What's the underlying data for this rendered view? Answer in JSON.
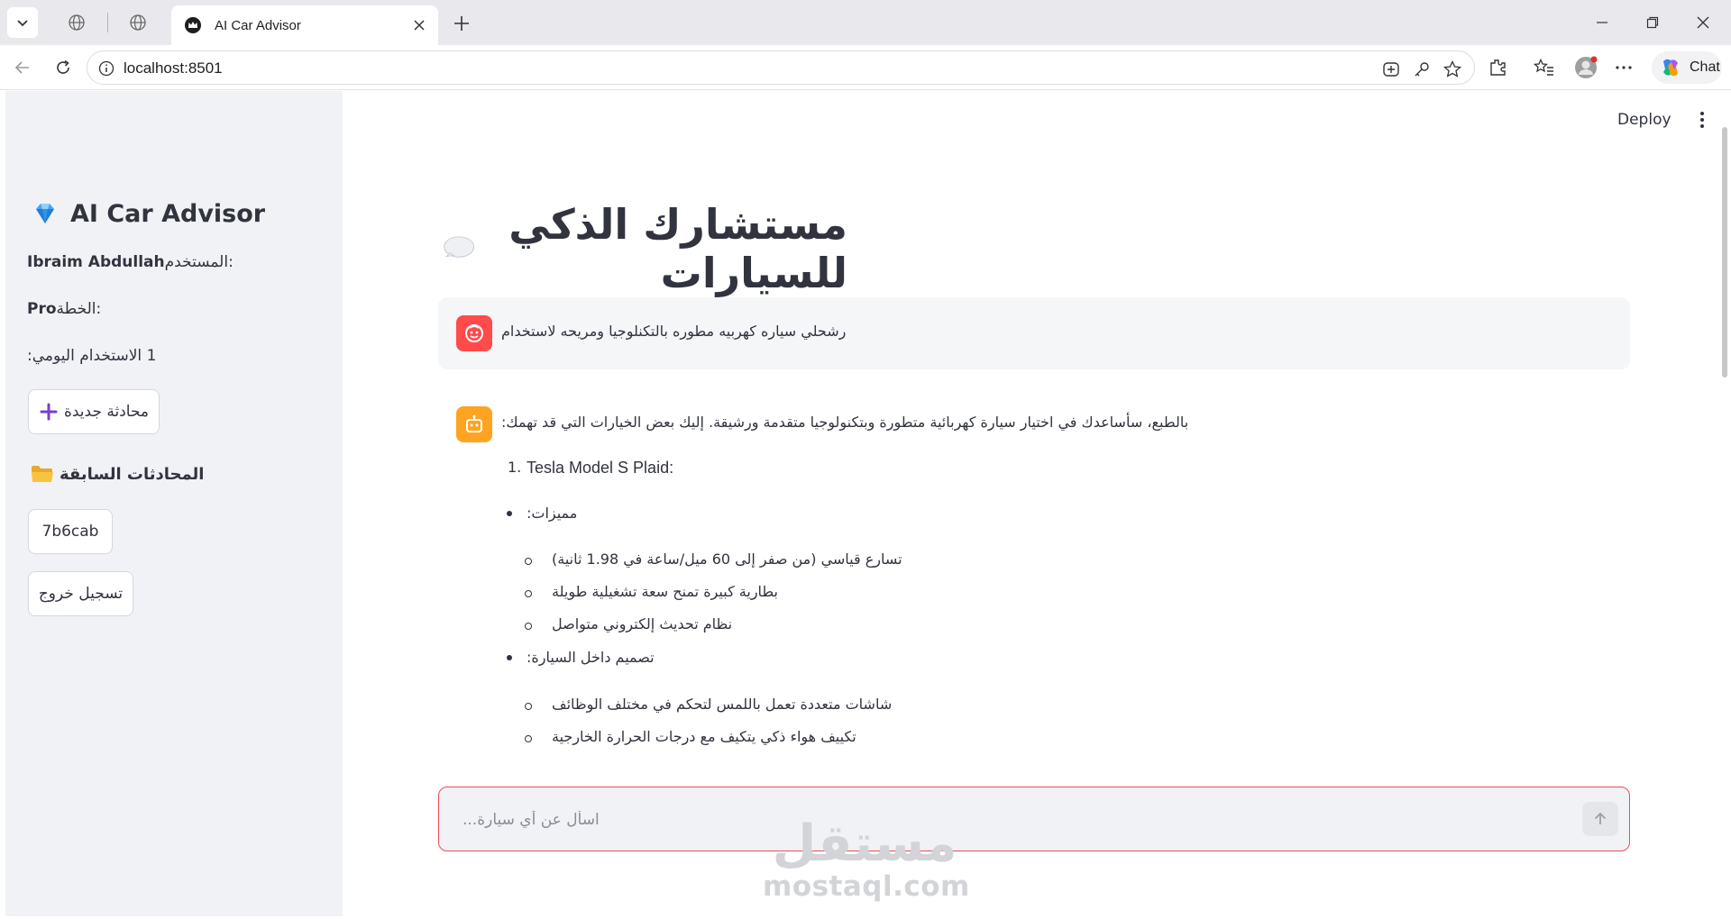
{
  "browser": {
    "tab_title": "AI Car Advisor",
    "url": "localhost:8501",
    "chat_label": "Chat"
  },
  "sidebar": {
    "app_title": "AI Car Advisor",
    "user_label": "المستخدم:",
    "user_name": "Ibraim Abdullah",
    "plan_label": "الخطة:",
    "plan_value": "Pro",
    "usage_label": "الاستخدام اليومي:",
    "usage_value": "1",
    "new_chat_label": "محادثة جديدة",
    "history_title": "المحادثات السابقة",
    "history_items": [
      "7b6cab"
    ],
    "logout_label": "تسجيل خروج"
  },
  "header": {
    "deploy_label": "Deploy"
  },
  "main": {
    "page_title": "مستشارك الذكي للسيارات",
    "user_message": "رشحلي سياره كهربيه مطوره بالتكنلوجيا ومريحه لاستخدام",
    "assistant": {
      "intro": "بالطبع، سأساعدك في اختيار سيارة كهربائية متطورة وبتكنولوجيا متقدمة ورشيقة. إليك بعض الخيارات التي قد تهمك:",
      "item1_number": "1.",
      "item1_title": "Tesla Model S Plaid:",
      "features_heading": "مميزات:",
      "features": [
        "تسارع قياسي (من صفر إلى 60 ميل/ساعة في 1.98 ثانية)",
        "بطارية كبيرة تمنح سعة تشغيلية طويلة",
        "نظام تحديث إلكتروني متواصل"
      ],
      "interior_heading": "تصميم داخل السيارة:",
      "interior": [
        "شاشات متعددة تعمل باللمس لتحكم في مختلف الوظائف",
        "تكييف هواء ذكي يتكيف مع درجات الحرارة الخارجية"
      ]
    },
    "input_placeholder": "اسأل عن أي سيارة..."
  },
  "watermark": {
    "arabic": "مستقل",
    "latin": "mostaql.com"
  }
}
